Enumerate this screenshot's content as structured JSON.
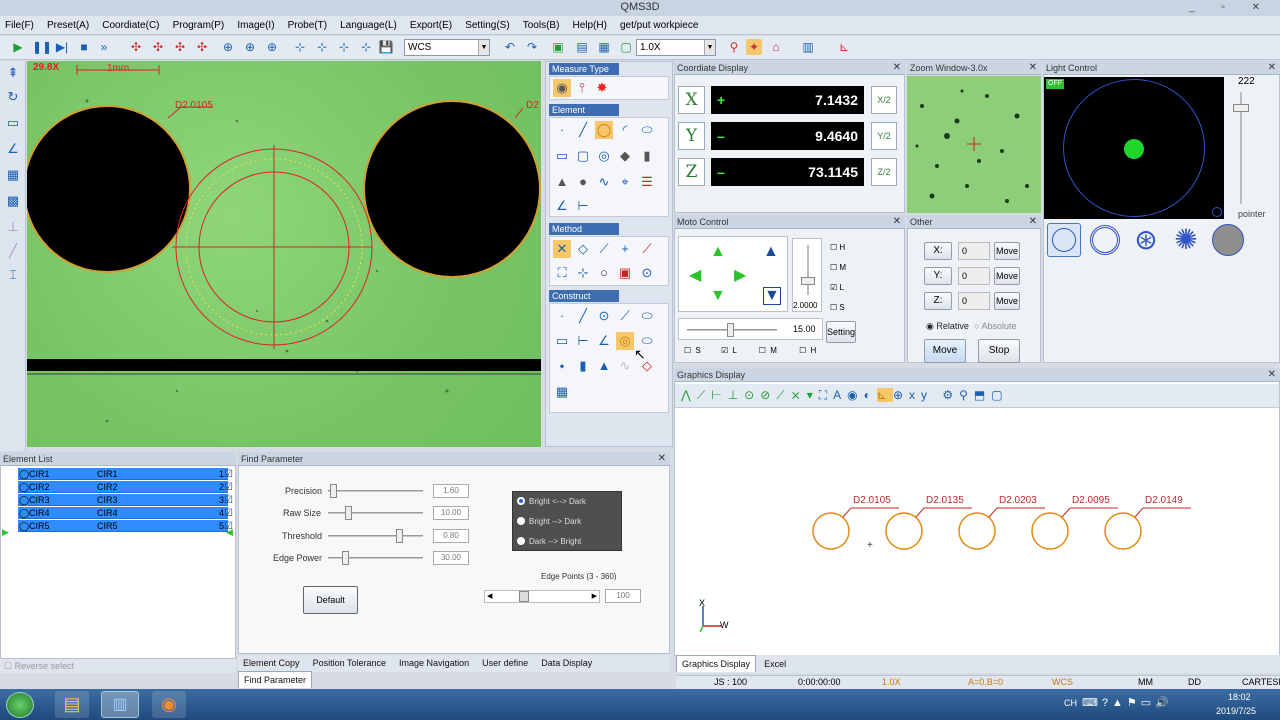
{
  "app": {
    "title": "QMS3D"
  },
  "menu": [
    "File(F)",
    "Preset(A)",
    "Coordiate(C)",
    "Program(P)",
    "Image(I)",
    "Probe(T)",
    "Language(L)",
    "Export(E)",
    "Setting(S)",
    "Tools(B)",
    "Help(H)",
    "get/put workpiece"
  ],
  "toolbar": {
    "coord_system": "WCS",
    "zoom": "1.0X"
  },
  "camera": {
    "magnification": "29.8X",
    "scale": "1mm",
    "label_left": "D2.0105",
    "label_right": "D2"
  },
  "measure_type": {
    "title": "Measure Type"
  },
  "element": {
    "title": "Element"
  },
  "method": {
    "title": "Method"
  },
  "construct": {
    "title": "Construct"
  },
  "coord_display": {
    "title": "Coordiate Display",
    "rows": [
      {
        "axis": "X",
        "sign": "+",
        "value": "7.1432",
        "half": "X/2"
      },
      {
        "axis": "Y",
        "sign": "–",
        "value": "9.4640",
        "half": "Y/2"
      },
      {
        "axis": "Z",
        "sign": "–",
        "value": "73.1145",
        "half": "Z/2"
      }
    ]
  },
  "zoom_window": {
    "title": "Zoom Window-3.0x"
  },
  "light_control": {
    "title": "Light Control",
    "value": "222",
    "off_label": "OFF",
    "pointer_label": "pointer"
  },
  "moto_control": {
    "title": "Moto Control",
    "speed": "2.0000",
    "slider_value": "15.00",
    "setting": "Setting",
    "checks": [
      "H",
      "M",
      "L",
      "S"
    ],
    "bottom_checks": [
      "S",
      "L",
      "M",
      "H"
    ]
  },
  "other": {
    "title": "Other",
    "rows": [
      {
        "label": "X:",
        "value": "0",
        "button": "Move"
      },
      {
        "label": "Y:",
        "value": "0",
        "button": "Move"
      },
      {
        "label": "Z:",
        "value": "0",
        "button": "Move"
      }
    ],
    "relative": "Relative",
    "absolute": "Absolute",
    "move": "Move",
    "stop": "Stop"
  },
  "graphics": {
    "title": "Graphics Display",
    "labels": [
      "D2.0105",
      "D2.0135",
      "D2.0203",
      "D2.0095",
      "D2.0149"
    ],
    "axis_x": "X",
    "axis_w": "W"
  },
  "element_list": {
    "title": "Element List",
    "items": [
      {
        "name": "CIR1",
        "label": "CIR1",
        "num": "1"
      },
      {
        "name": "CIR2",
        "label": "CIR2",
        "num": "2"
      },
      {
        "name": "CIR3",
        "label": "CIR3",
        "num": "3"
      },
      {
        "name": "CIR4",
        "label": "CIR4",
        "num": "4"
      },
      {
        "name": "CIR5",
        "label": "CIR5",
        "num": "5"
      }
    ],
    "reverse_select": "Reverse select"
  },
  "find_param": {
    "title": "Find Parameter",
    "params": [
      {
        "label": "Precision",
        "value": "1.60"
      },
      {
        "label": "Raw Size",
        "value": "10.00"
      },
      {
        "label": "Threshold",
        "value": "0.80"
      },
      {
        "label": "Edge Power",
        "value": "30.00"
      }
    ],
    "default_btn": "Default",
    "options": [
      "Bright <--> Dark",
      "Bright --> Dark",
      "Dark --> Bright"
    ],
    "edge_points_label": "Edge Points (3 - 360)",
    "edge_points_value": "100"
  },
  "bottom_tabs": [
    "Element Copy",
    "Position Tolerance",
    "Image Navigation",
    "User define",
    "Data Display",
    "Find Parameter"
  ],
  "right_tabs": [
    "Graphics Display",
    "Excel"
  ],
  "status": {
    "js": "JS : 100",
    "time": "0:00:00:00",
    "zoom": "1.0X",
    "ab": "A=0,B=0",
    "wcs": "WCS",
    "mm": "MM",
    "dd": "DD",
    "mode": "CARTESI"
  },
  "taskbar": {
    "time": "18:02",
    "date": "2019/7/25",
    "lang": "CH"
  }
}
